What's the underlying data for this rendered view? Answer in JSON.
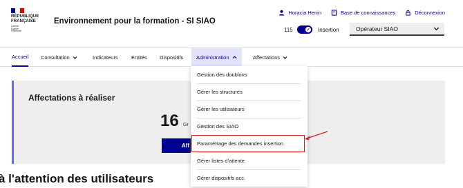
{
  "header": {
    "logo": {
      "line1": "RÉPUBLIQUE",
      "line2": "FRANÇAISE",
      "motto": [
        "Liberté",
        "Égalité",
        "Fraternité"
      ]
    },
    "site_title": "Environnement pour la formation - SI SIAO",
    "links": [
      {
        "label": "Horacia Henin",
        "icon": "user-icon"
      },
      {
        "label": "Base de connaissances",
        "icon": "book-icon"
      },
      {
        "label": "Déconnexion",
        "icon": "lock-icon"
      }
    ],
    "count": "115",
    "toggle_label": "Insertion",
    "role_select": "Opérateur SIAO"
  },
  "nav": {
    "items": [
      "Accueil",
      "Consultation",
      "Indicateurs",
      "Entités",
      "Dispositifs",
      "Administration",
      "Affectations"
    ]
  },
  "main": {
    "card_title": "Affectations à réaliser",
    "big_number": "16",
    "big_number_sub": "Gr",
    "button_label": "Aff",
    "section_title": "à l'attention des utilisateurs"
  },
  "admin_menu": {
    "items": [
      "Gestion des doublons",
      "Gérer les structures",
      "Gérer les utilisateurs",
      "Gestion des SIAO",
      "Paramétrage des demandes insertion",
      "Gérer listes d'attente",
      "Gérer dispositifs acc."
    ]
  },
  "colors": {
    "primary": "#000091",
    "accent_border": "#6a6af4",
    "highlight": "#d91e1e",
    "card_bg": "#eeeeee"
  }
}
